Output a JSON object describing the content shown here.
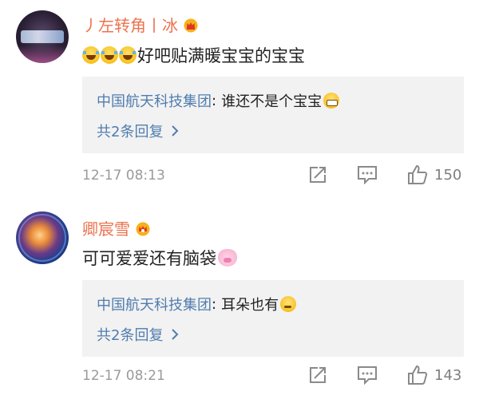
{
  "comments": [
    {
      "username": "丿左转角丨冰",
      "text": "好吧贴满暖宝宝的宝宝",
      "reply": {
        "author": "中国航天科技集团",
        "separator": ":",
        "text": "谁还不是个宝宝"
      },
      "reply_count": "共2条回复",
      "timestamp": "12-17 08:13",
      "likes": "150"
    },
    {
      "username": "卿宸雪",
      "text": "可可爱爱还有脑袋",
      "reply": {
        "author": "中国航天科技集团",
        "separator": ":",
        "text": "耳朵也有"
      },
      "reply_count": "共2条回复",
      "timestamp": "12-17 08:21",
      "likes": "143"
    }
  ],
  "icons": {
    "crown": "crown-icon",
    "forward": "forward-icon",
    "comment": "comment-icon",
    "like": "thumbs-up-icon",
    "chevron": "chevron-right-icon"
  },
  "colors": {
    "username": "#eb7350",
    "reply_link": "#507daf",
    "meta": "#9a9a9a",
    "reply_bg": "#f2f2f2"
  }
}
